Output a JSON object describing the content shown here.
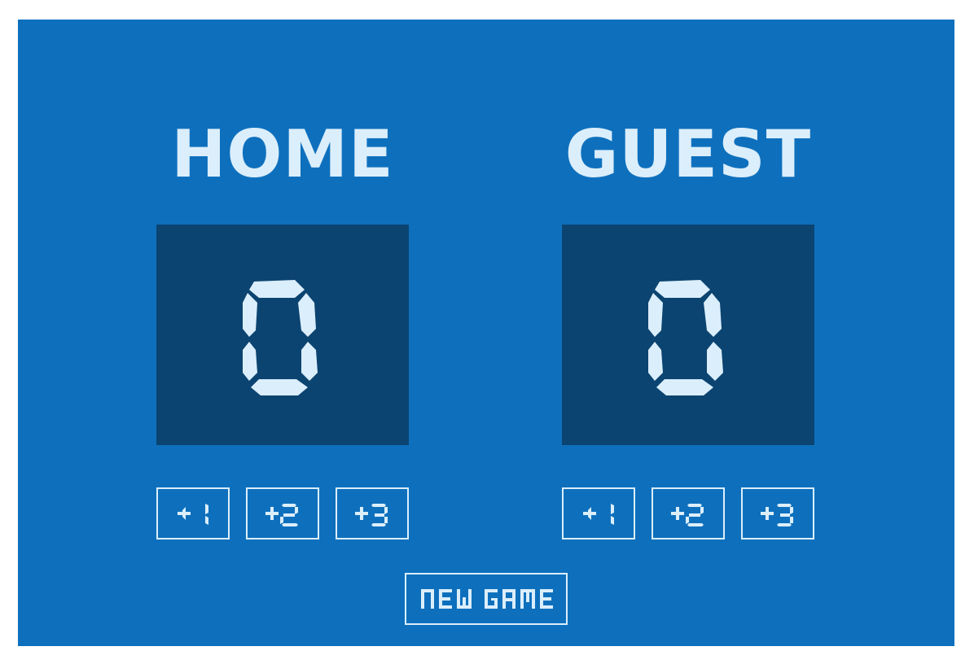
{
  "colors": {
    "board_bg": "#0e70bd",
    "score_bg": "#0b4471",
    "foreground": "#dbeefb"
  },
  "home": {
    "label": "HOME",
    "score": "0",
    "buttons": [
      "+1",
      "+2",
      "+3"
    ]
  },
  "guest": {
    "label": "GUEST",
    "score": "0",
    "buttons": [
      "+1",
      "+2",
      "+3"
    ]
  },
  "new_game_label": "NEW GAME"
}
